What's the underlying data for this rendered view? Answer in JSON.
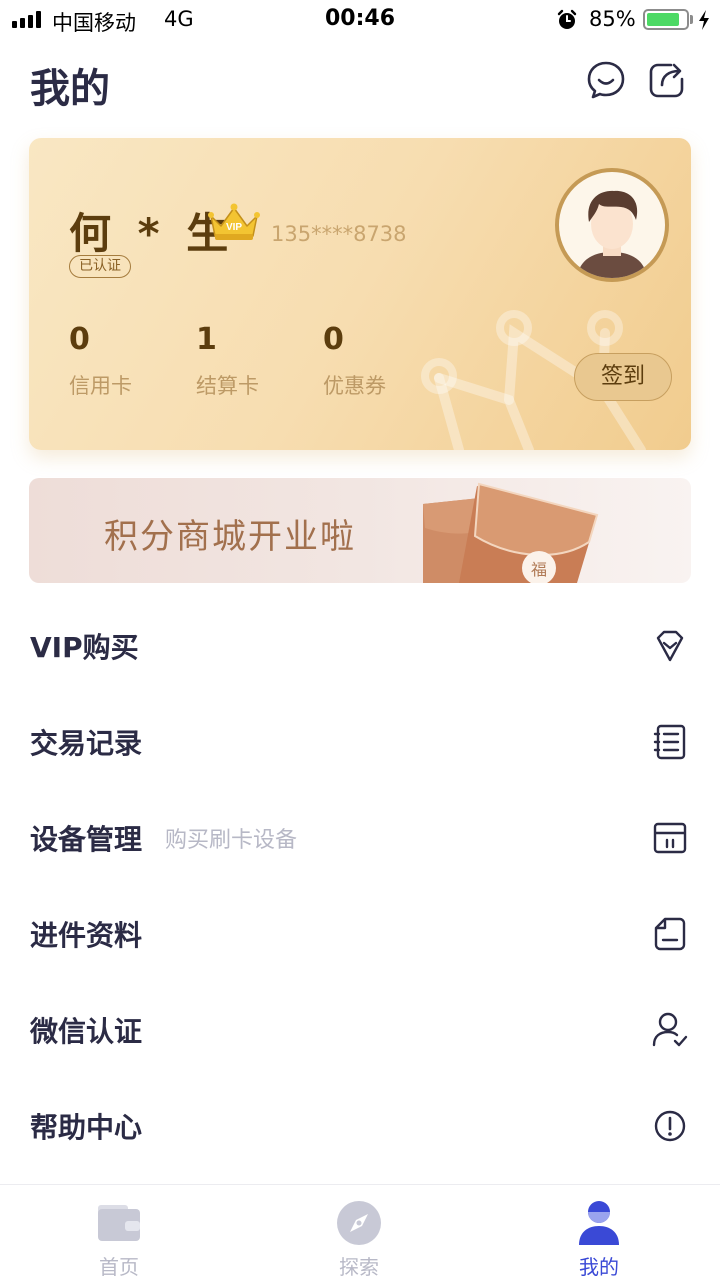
{
  "status_bar": {
    "carrier": "中国移动",
    "network": "4G",
    "time": "00:46",
    "battery_percent": "85%",
    "battery_level": 0.85
  },
  "header": {
    "title": "我的",
    "icons": [
      "chat-bubble-icon",
      "share-icon"
    ]
  },
  "member_card": {
    "name": "何 * 生",
    "phone": "135****8738",
    "verified_label": "已认证",
    "crown_badge": "VIP",
    "stats": [
      {
        "value": "0",
        "label": "信用卡"
      },
      {
        "value": "1",
        "label": "结算卡"
      },
      {
        "value": "0",
        "label": "优惠券"
      }
    ],
    "checkin_label": "签到"
  },
  "banner": {
    "text": "积分商城开业啦",
    "envelope_glyph": "福"
  },
  "menu": [
    {
      "label": "VIP购买",
      "sub": "",
      "icon": "diamond-icon"
    },
    {
      "label": "交易记录",
      "sub": "",
      "icon": "list-icon"
    },
    {
      "label": "设备管理",
      "sub": "购买刷卡设备",
      "icon": "card-reader-icon"
    },
    {
      "label": "进件资料",
      "sub": "",
      "icon": "document-icon"
    },
    {
      "label": "微信认证",
      "sub": "",
      "icon": "user-check-icon"
    },
    {
      "label": "帮助中心",
      "sub": "",
      "icon": "info-icon"
    }
  ],
  "tab_bar": {
    "tabs": [
      {
        "label": "首页",
        "icon": "wallet-icon",
        "active": false
      },
      {
        "label": "探索",
        "icon": "compass-icon",
        "active": false
      },
      {
        "label": "我的",
        "icon": "person-icon",
        "active": true
      }
    ]
  },
  "colors": {
    "accent": "#3a49d6",
    "card_gold": "#f7ddb0",
    "title_text": "#2b2b45",
    "muted_text": "#b7b8c6"
  }
}
